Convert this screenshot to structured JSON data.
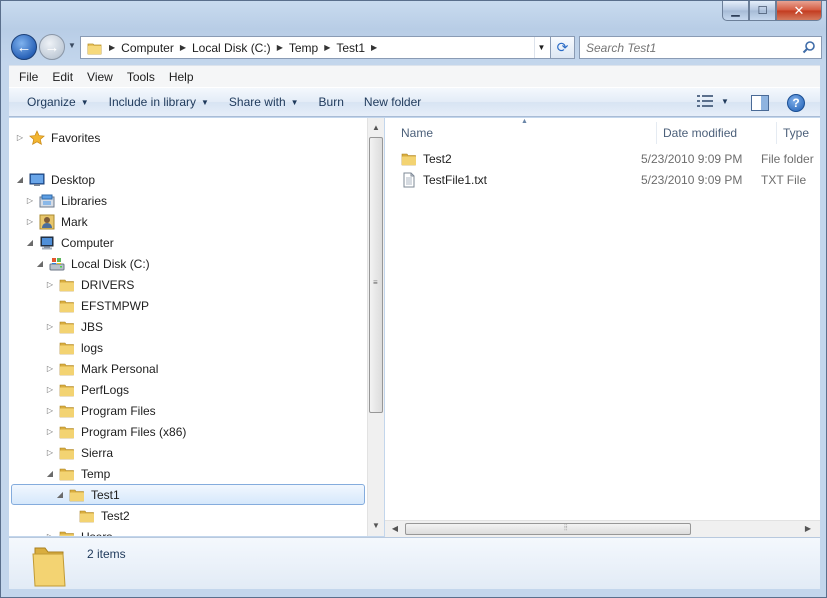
{
  "window": {
    "caption": {
      "minimize": "▁",
      "maximize": "☐",
      "close": "✕"
    }
  },
  "nav": {
    "back_icon": "back-arrow-icon",
    "forward_icon": "forward-arrow-icon",
    "back_glyph": "←",
    "forward_glyph": "→",
    "breadcrumb": [
      "Computer",
      "Local Disk (C:)",
      "Temp",
      "Test1"
    ],
    "search_placeholder": "Search Test1"
  },
  "menubar": [
    "File",
    "Edit",
    "View",
    "Tools",
    "Help"
  ],
  "commandbar": {
    "organize": "Organize",
    "include_in_library": "Include in library",
    "share_with": "Share with",
    "burn": "Burn",
    "new_folder": "New folder",
    "help": "?"
  },
  "tree": [
    {
      "label": "Favorites",
      "level": 0,
      "arrow": "▷",
      "icon": "star"
    },
    {
      "label": "Desktop",
      "level": 0,
      "arrow": "◢",
      "icon": "desktop"
    },
    {
      "label": "Libraries",
      "level": 1,
      "arrow": "▷",
      "icon": "library"
    },
    {
      "label": "Mark",
      "level": 1,
      "arrow": "▷",
      "icon": "user"
    },
    {
      "label": "Computer",
      "level": 1,
      "arrow": "◢",
      "icon": "computer"
    },
    {
      "label": "Local Disk (C:)",
      "level": 2,
      "arrow": "◢",
      "icon": "drive"
    },
    {
      "label": "DRIVERS",
      "level": 3,
      "arrow": "▷",
      "icon": "folder"
    },
    {
      "label": "EFSTMPWP",
      "level": 3,
      "arrow": "",
      "icon": "folder"
    },
    {
      "label": "JBS",
      "level": 3,
      "arrow": "▷",
      "icon": "folder"
    },
    {
      "label": "logs",
      "level": 3,
      "arrow": "",
      "icon": "folder"
    },
    {
      "label": "Mark Personal",
      "level": 3,
      "arrow": "▷",
      "icon": "folder"
    },
    {
      "label": "PerfLogs",
      "level": 3,
      "arrow": "▷",
      "icon": "folder"
    },
    {
      "label": "Program Files",
      "level": 3,
      "arrow": "▷",
      "icon": "folder"
    },
    {
      "label": "Program Files (x86)",
      "level": 3,
      "arrow": "▷",
      "icon": "folder"
    },
    {
      "label": "Sierra",
      "level": 3,
      "arrow": "▷",
      "icon": "folder"
    },
    {
      "label": "Temp",
      "level": 3,
      "arrow": "◢",
      "icon": "folder"
    },
    {
      "label": "Test1",
      "level": 4,
      "arrow": "◢",
      "icon": "folder",
      "selected": true
    },
    {
      "label": "Test2",
      "level": 5,
      "arrow": "",
      "icon": "folder"
    },
    {
      "label": "Users",
      "level": 3,
      "arrow": "▷",
      "icon": "folder"
    }
  ],
  "columns": {
    "name": "Name",
    "date": "Date modified",
    "type": "Type"
  },
  "files": [
    {
      "name": "Test2",
      "date": "5/23/2010 9:09 PM",
      "type": "File folder",
      "icon": "folder"
    },
    {
      "name": "TestFile1.txt",
      "date": "5/23/2010 9:09 PM",
      "type": "TXT File",
      "icon": "text-file"
    }
  ],
  "details": {
    "count": "2 items"
  }
}
